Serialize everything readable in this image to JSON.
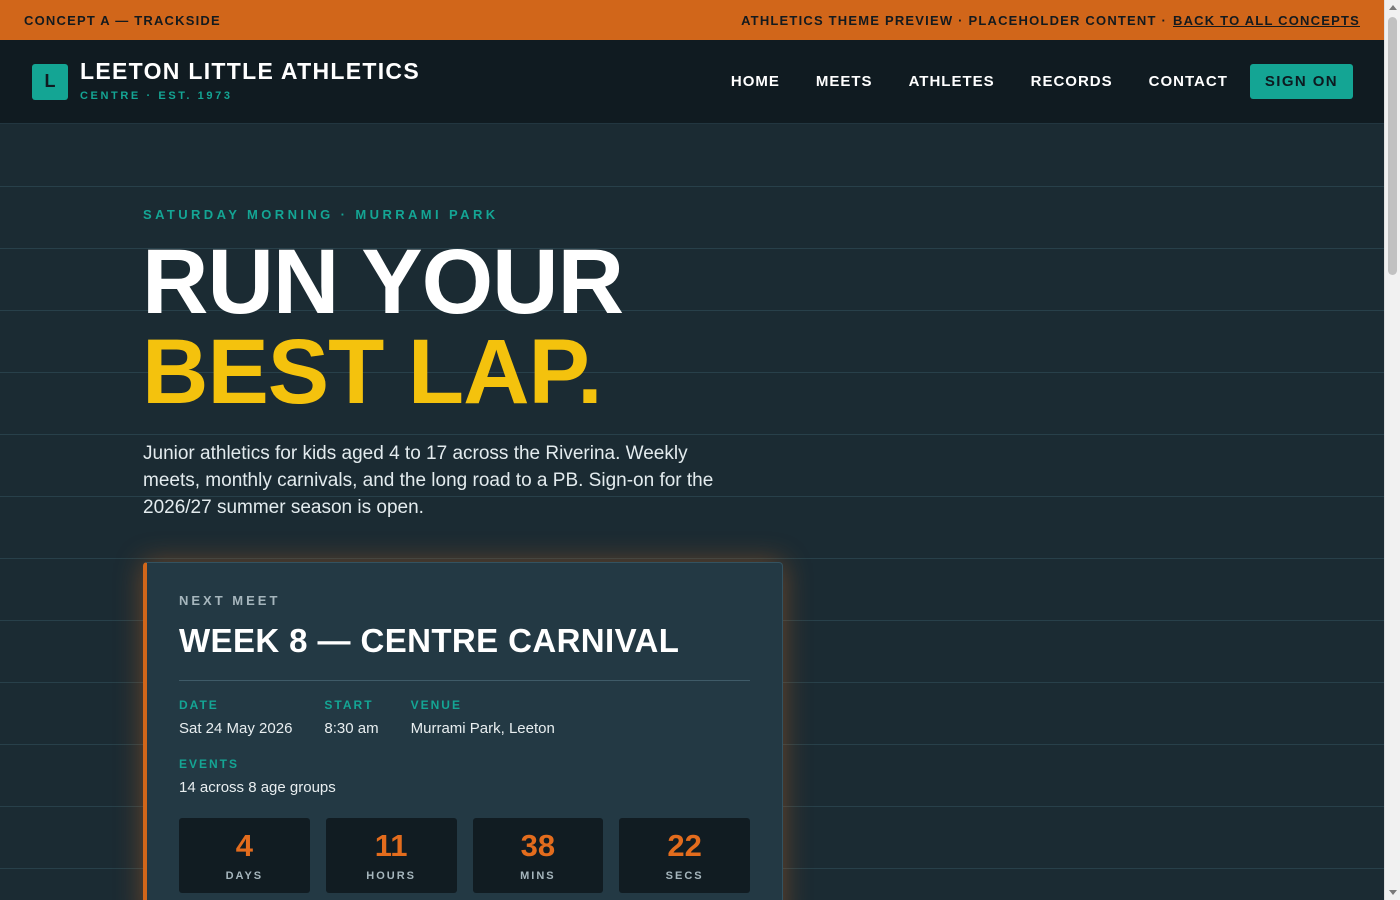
{
  "banner": {
    "concept": "CONCEPT A — TRACKSIDE",
    "preview": "ATHLETICS THEME PREVIEW · PLACEHOLDER CONTENT ·",
    "back_link": "BACK TO ALL CONCEPTS"
  },
  "nav": {
    "logo_letter": "L",
    "title": "LEETON LITTLE ATHLETICS",
    "subtitle": "CENTRE · EST. 1973",
    "items": [
      {
        "label": "HOME"
      },
      {
        "label": "MEETS"
      },
      {
        "label": "ATHLETES"
      },
      {
        "label": "RECORDS"
      },
      {
        "label": "CONTACT"
      }
    ],
    "cta": "SIGN ON"
  },
  "hero": {
    "kicker": "SATURDAY MORNING · MURRAMI PARK",
    "headline_line1": "RUN YOUR",
    "headline_line2": "BEST LAP.",
    "lede": "Junior athletics for kids aged 4 to 17 across the Riverina. Weekly meets, monthly carnivals, and the long road to a PB. Sign-on for the 2026/27 summer season is open."
  },
  "next_meet": {
    "kicker": "NEXT MEET",
    "title": "WEEK 8 — CENTRE CARNIVAL",
    "facts": [
      {
        "label": "DATE",
        "value": "Sat 24 May 2026"
      },
      {
        "label": "START",
        "value": "8:30 am"
      },
      {
        "label": "VENUE",
        "value": "Murrami Park, Leeton"
      }
    ],
    "events": {
      "label": "EVENTS",
      "value": "14 across 8 age groups"
    },
    "countdown": [
      {
        "value": "4",
        "unit": "DAYS"
      },
      {
        "value": "11",
        "unit": "HOURS"
      },
      {
        "value": "38",
        "unit": "MINS"
      },
      {
        "value": "22",
        "unit": "SECS"
      }
    ]
  },
  "colors": {
    "accent_orange": "#d1661a",
    "accent_teal": "#14a594",
    "accent_yellow": "#f4c20d",
    "background": "#1b2b33",
    "nav_background": "#101b21"
  }
}
